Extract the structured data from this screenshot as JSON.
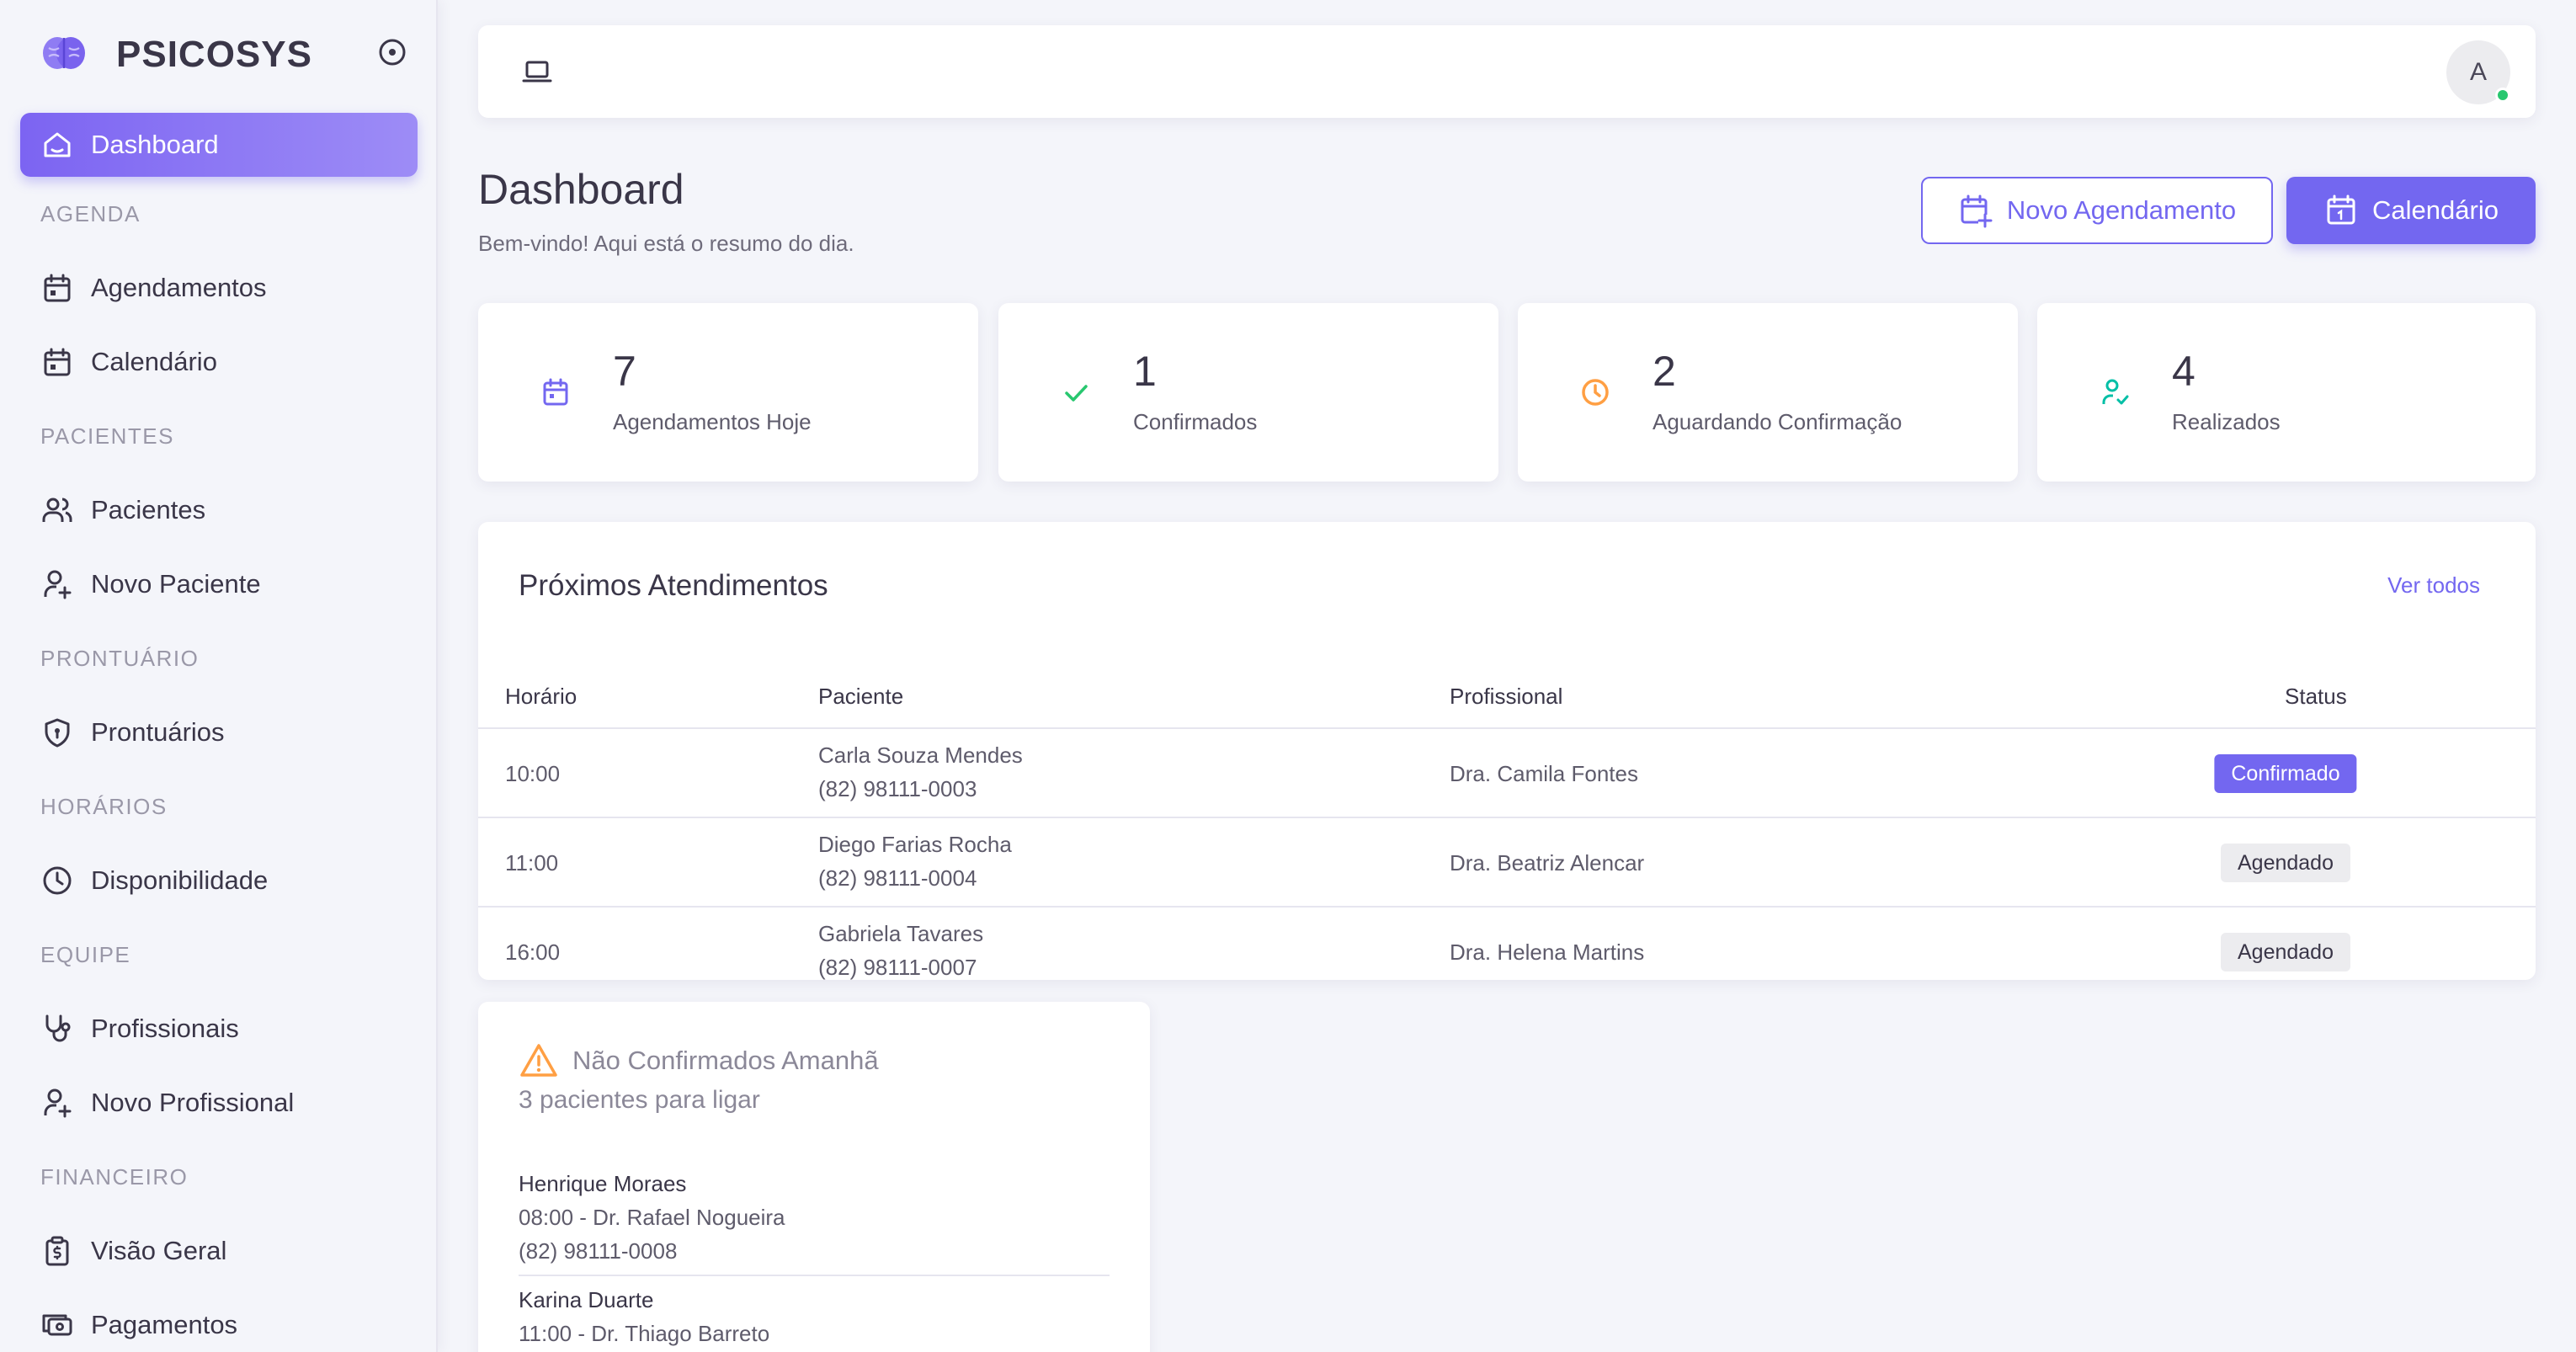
{
  "app": {
    "brand": "PSICOSYS"
  },
  "sidebar": {
    "dashboard": "Dashboard",
    "sections": {
      "agenda": "AGENDA",
      "pacientes": "PACIENTES",
      "prontuario": "PRONTUÁRIO",
      "horarios": "HORÁRIOS",
      "equipe": "EQUIPE",
      "financeiro": "FINANCEIRO"
    },
    "items": {
      "agendamentos": "Agendamentos",
      "calendario": "Calendário",
      "pacientes": "Pacientes",
      "novo_paciente": "Novo Paciente",
      "prontuarios": "Prontuários",
      "disponibilidade": "Disponibilidade",
      "profissionais": "Profissionais",
      "novo_profissional": "Novo Profissional",
      "visao_geral": "Visão Geral",
      "pagamentos": "Pagamentos"
    }
  },
  "topbar": {
    "avatar_initial": "A"
  },
  "page": {
    "title": "Dashboard",
    "subtitle": "Bem-vindo! Aqui está o resumo do dia.",
    "btn_new": "Novo Agendamento",
    "btn_calendar": "Calendário"
  },
  "stats": [
    {
      "value": "7",
      "label": "Agendamentos Hoje",
      "icon": "calendar-icon",
      "color": "#7367f0"
    },
    {
      "value": "1",
      "label": "Confirmados",
      "icon": "check-icon",
      "color": "#28c76f"
    },
    {
      "value": "2",
      "label": "Aguardando Confirmação",
      "icon": "clock-icon",
      "color": "#ff9f43"
    },
    {
      "value": "4",
      "label": "Realizados",
      "icon": "user-check-icon",
      "color": "#00bfa6"
    }
  ],
  "upcoming": {
    "title": "Próximos Atendimentos",
    "view_all": "Ver todos",
    "columns": {
      "time": "Horário",
      "patient": "Paciente",
      "professional": "Profissional",
      "status": "Status"
    },
    "rows": [
      {
        "time": "10:00",
        "patient": "Carla Souza Mendes",
        "phone": "(82) 98111-0003",
        "professional": "Dra. Camila Fontes",
        "status": "Confirmado"
      },
      {
        "time": "11:00",
        "patient": "Diego Farias Rocha",
        "phone": "(82) 98111-0004",
        "professional": "Dra. Beatriz Alencar",
        "status": "Agendado"
      },
      {
        "time": "16:00",
        "patient": "Gabriela Tavares",
        "phone": "(82) 98111-0007",
        "professional": "Dra. Helena Martins",
        "status": "Agendado"
      }
    ]
  },
  "unconfirmed": {
    "title": "Não Confirmados Amanhã",
    "subtitle": "3 pacientes para ligar",
    "items": [
      {
        "name": "Henrique Moraes",
        "detail": "08:00 - Dr. Rafael Nogueira",
        "phone": "(82) 98111-0008"
      },
      {
        "name": "Karina Duarte",
        "detail": "11:00 - Dr. Thiago Barreto"
      }
    ]
  },
  "colors": {
    "accent": "#7367f0",
    "success": "#28c76f",
    "warning": "#ff9f43",
    "teal": "#00bfa6"
  }
}
